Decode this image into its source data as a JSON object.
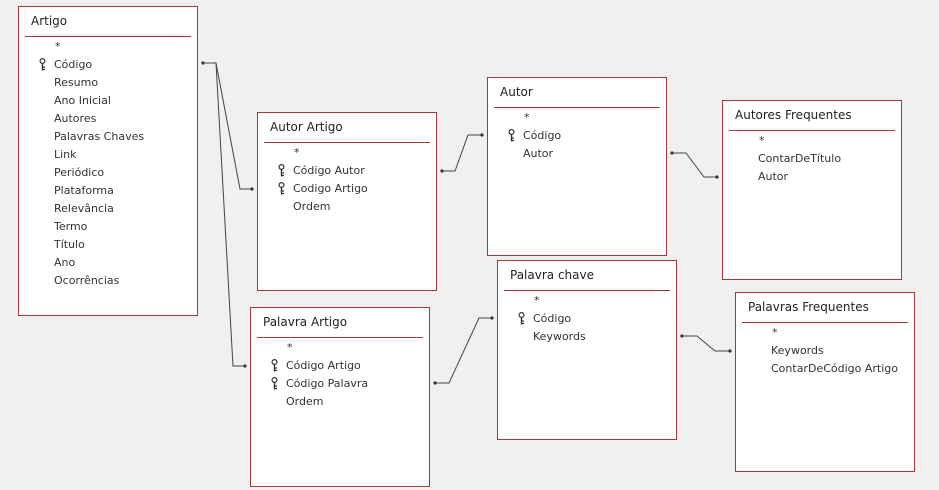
{
  "tables": {
    "artigo": {
      "title": "Artigo",
      "fields": [
        {
          "label": "*",
          "key": false
        },
        {
          "label": "Código",
          "key": true
        },
        {
          "label": "Resumo",
          "key": false
        },
        {
          "label": "Ano Inicial",
          "key": false
        },
        {
          "label": "Autores",
          "key": false
        },
        {
          "label": "Palavras Chaves",
          "key": false
        },
        {
          "label": "Link",
          "key": false
        },
        {
          "label": "Periódico",
          "key": false
        },
        {
          "label": "Plataforma",
          "key": false
        },
        {
          "label": "Relevância",
          "key": false
        },
        {
          "label": "Termo",
          "key": false
        },
        {
          "label": "Título",
          "key": false
        },
        {
          "label": "Ano",
          "key": false
        },
        {
          "label": "Ocorrências",
          "key": false
        }
      ]
    },
    "autor_artigo": {
      "title": "Autor Artigo",
      "fields": [
        {
          "label": "*",
          "key": false
        },
        {
          "label": "Código Autor",
          "key": true
        },
        {
          "label": "Codigo Artigo",
          "key": true
        },
        {
          "label": "Ordem",
          "key": false
        }
      ]
    },
    "palavra_artigo": {
      "title": "Palavra Artigo",
      "fields": [
        {
          "label": "*",
          "key": false
        },
        {
          "label": "Código Artigo",
          "key": true
        },
        {
          "label": "Código Palavra",
          "key": true
        },
        {
          "label": "Ordem",
          "key": false
        }
      ]
    },
    "autor": {
      "title": "Autor",
      "fields": [
        {
          "label": "*",
          "key": false
        },
        {
          "label": "Código",
          "key": true
        },
        {
          "label": "Autor",
          "key": false
        }
      ]
    },
    "palavra_chave": {
      "title": "Palavra chave",
      "fields": [
        {
          "label": "*",
          "key": false
        },
        {
          "label": "Código",
          "key": true
        },
        {
          "label": "Keywords",
          "key": false
        }
      ]
    },
    "autores_frequentes": {
      "title": "Autores Frequentes",
      "fields": [
        {
          "label": "*",
          "key": false
        },
        {
          "label": "ContarDeTítulo",
          "key": false
        },
        {
          "label": "Autor",
          "key": false
        }
      ]
    },
    "palavras_frequentes": {
      "title": "Palavras Frequentes",
      "fields": [
        {
          "label": "*",
          "key": false
        },
        {
          "label": "Keywords",
          "key": false
        },
        {
          "label": "ContarDeCódigo Artigo",
          "key": false
        }
      ]
    }
  },
  "colors": {
    "canvas_background": "#f0f0f0",
    "table_border": "#a4373a",
    "connector_line": "#444444"
  },
  "icons": {
    "primary_key": "key-icon"
  }
}
